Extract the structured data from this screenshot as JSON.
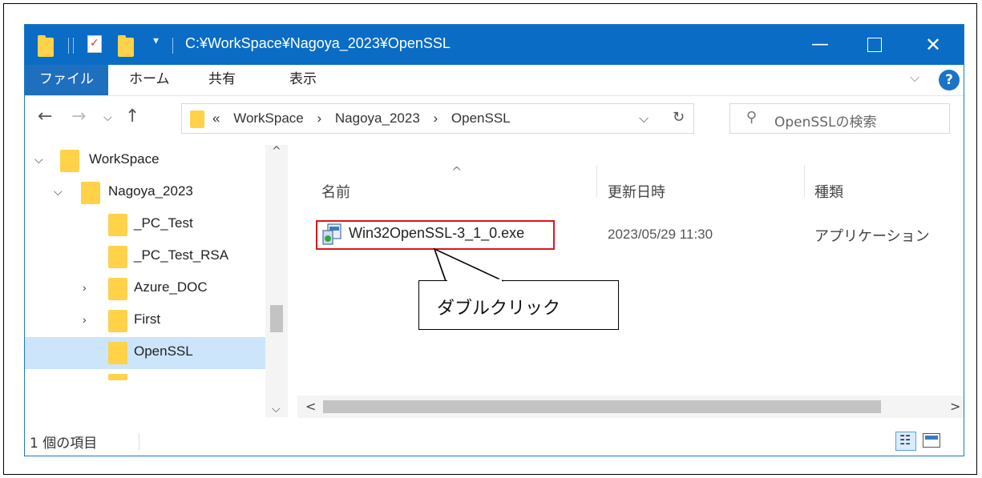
{
  "window": {
    "title": "C:¥WorkSpace¥Nagoya_2023¥OpenSSL",
    "minimize_glyph": "—",
    "close_glyph": "✕"
  },
  "ribbon": {
    "tabs": [
      "ファイル",
      "ホーム",
      "共有",
      "表示"
    ],
    "collapse_glyph": "⌵",
    "help_glyph": "?"
  },
  "nav": {
    "back_glyph": "←",
    "forward_glyph": "→",
    "recent_glyph": "⌵",
    "up_glyph": "↑"
  },
  "address": {
    "overflow": "«",
    "crumbs": [
      "WorkSpace",
      "Nagoya_2023",
      "OpenSSL"
    ],
    "separator": "›",
    "dropdown_glyph": "⌵",
    "refresh_glyph": "↻"
  },
  "search": {
    "placeholder": "OpenSSLの検索",
    "icon": "search-icon",
    "glyph": "⚲"
  },
  "tree": {
    "items": [
      {
        "label": "WorkSpace",
        "chevron": "⌵"
      },
      {
        "label": "Nagoya_2023",
        "chevron": "⌵"
      },
      {
        "label": "_PC_Test",
        "chevron": ""
      },
      {
        "label": "_PC_Test_RSA",
        "chevron": ""
      },
      {
        "label": "Azure_DOC",
        "chevron": "›"
      },
      {
        "label": "First",
        "chevron": "›"
      },
      {
        "label": "OpenSSL",
        "chevron": ""
      }
    ],
    "selected": "OpenSSL"
  },
  "columns": {
    "name": "名前",
    "modified": "更新日時",
    "type": "種類",
    "sort_glyph": "^"
  },
  "files": [
    {
      "name": "Win32OpenSSL-3_1_0.exe",
      "modified": "2023/05/29 11:30",
      "type": "アプリケーション"
    }
  ],
  "callout": {
    "text": "ダブルクリック"
  },
  "scroll": {
    "up": "^",
    "down": "⌵",
    "left": "<",
    "right": ">"
  },
  "status": {
    "count": "1 個の項目"
  },
  "colors": {
    "titlebar": "#0a6cc4",
    "file_tab": "#1f6fbf",
    "folder": "#ffd24a",
    "selection": "#cce5fb",
    "highlight_border": "#e0141b"
  }
}
